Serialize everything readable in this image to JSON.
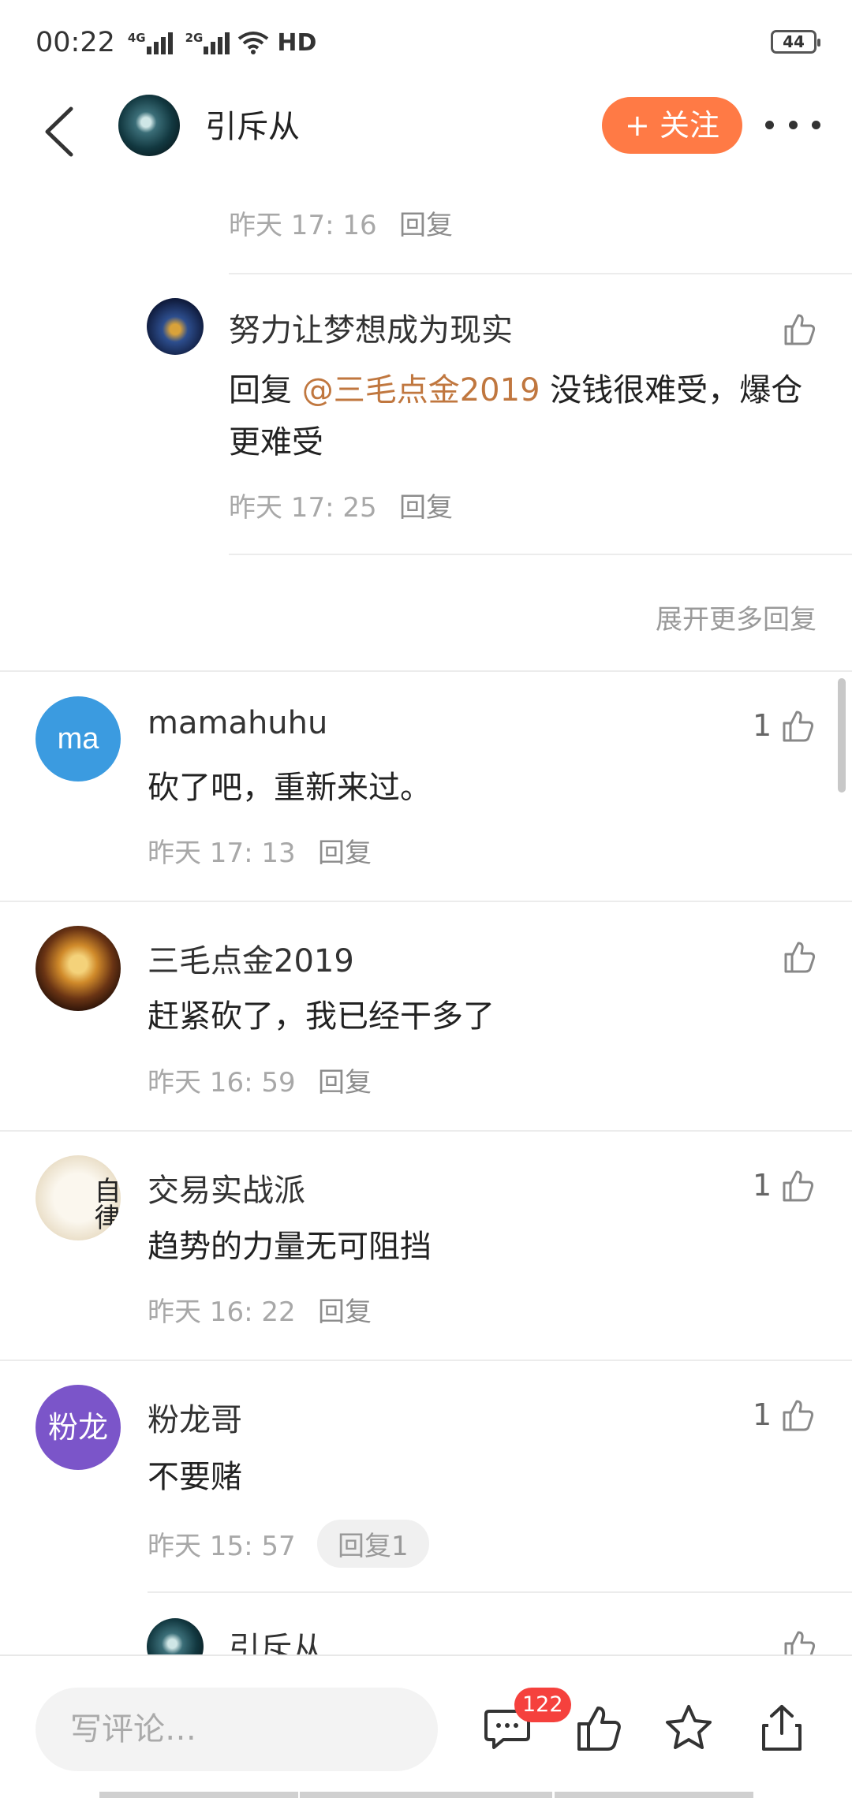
{
  "status_bar": {
    "time": "00:22",
    "net1": "4G",
    "net2": "2G",
    "hd": "HD",
    "battery": "44"
  },
  "header": {
    "title": "引斥从",
    "follow_label": "+ 关注"
  },
  "threads": {
    "prev_reply": {
      "time": "昨天 17: 16",
      "reply_label": "回复"
    },
    "sub_reply": {
      "name": "努力让梦想成为现实",
      "prefix": "回复 ",
      "mention": "@三毛点金2019",
      "text": " 没钱很难受，爆仓更难受",
      "time": "昨天 17: 25",
      "reply_label": "回复"
    },
    "expand_label": "展开更多回复",
    "comments": [
      {
        "avatar_text": "ma",
        "name": "mamahuhu",
        "likes": "1",
        "text": "砍了吧，重新来过。",
        "time": "昨天 17: 13",
        "reply_label": "回复"
      },
      {
        "avatar_text": "",
        "name": "三毛点金2019",
        "likes": "",
        "text": "赶紧砍了，我已经干多了",
        "time": "昨天 16: 59",
        "reply_label": "回复"
      },
      {
        "avatar_text": "自律",
        "name": "交易实战派",
        "likes": "1",
        "text": "趋势的力量无可阻挡",
        "time": "昨天 16: 22",
        "reply_label": "回复"
      },
      {
        "avatar_text": "粉龙",
        "name": "粉龙哥",
        "likes": "1",
        "text": "不要赌",
        "time": "昨天 15: 57",
        "reply_label": "回复1"
      }
    ],
    "partial_reply_name": "引斥从"
  },
  "bottom_bar": {
    "placeholder": "写评论…",
    "comment_count": "122"
  },
  "colors": {
    "accent": "#ff7a45",
    "mention": "#c0773f",
    "badge": "#f5413d",
    "ma_avatar": "#3b9be0",
    "fenlong_avatar": "#7b55c9"
  }
}
